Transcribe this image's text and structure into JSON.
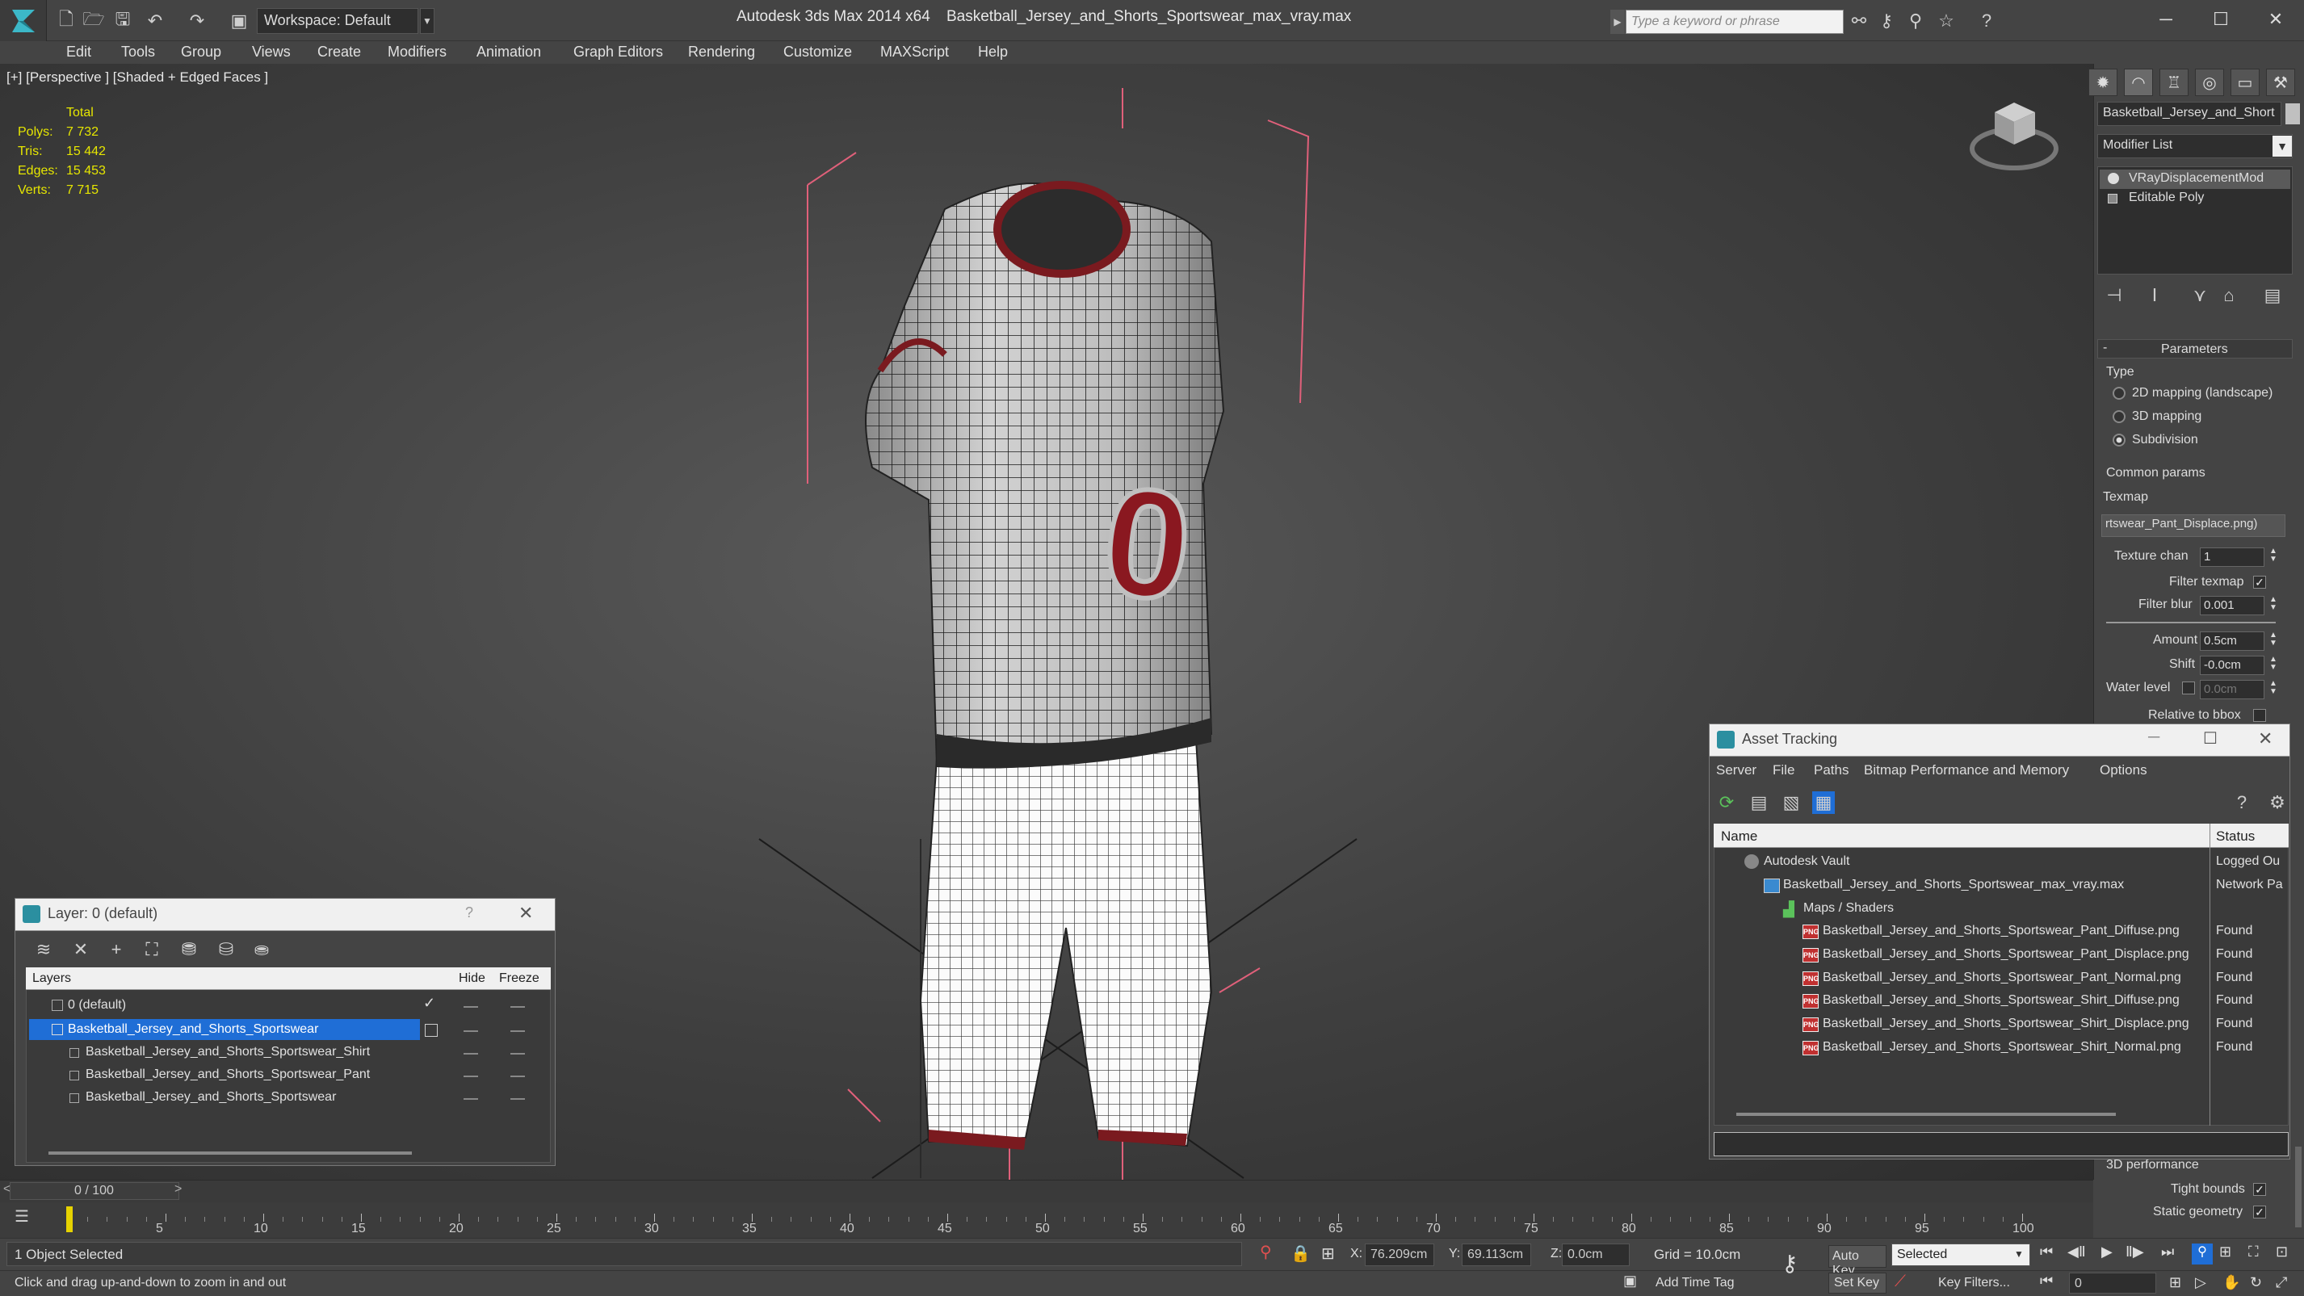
{
  "app": {
    "title": "Autodesk 3ds Max  2014 x64",
    "file": "Basketball_Jersey_and_Shorts_Sportswear_max_vray.max",
    "workspace": "Workspace: Default",
    "search_placeholder": "Type a keyword or phrase"
  },
  "menu": [
    "Edit",
    "Tools",
    "Group",
    "Views",
    "Create",
    "Modifiers",
    "Animation",
    "Graph Editors",
    "Rendering",
    "Customize",
    "MAXScript",
    "Help"
  ],
  "viewport": {
    "label": "[+] [Perspective ] [Shaded + Edged Faces ]",
    "stats": {
      "header": "Total",
      "rows": [
        {
          "label": "Polys:",
          "value": "7 732"
        },
        {
          "label": "Tris:",
          "value": "15 442"
        },
        {
          "label": "Edges:",
          "value": "15 453"
        },
        {
          "label": "Verts:",
          "value": "7 715"
        }
      ]
    },
    "jersey_number": "0"
  },
  "command_panel": {
    "object_name": "Basketball_Jersey_and_Short",
    "modifier_list": "Modifier List",
    "stack": [
      "VRayDisplacementMod",
      "Editable Poly"
    ],
    "rollout_title": "Parameters",
    "type_label": "Type",
    "type_options": [
      {
        "label": "2D mapping (landscape)",
        "selected": false
      },
      {
        "label": "3D mapping",
        "selected": false
      },
      {
        "label": "Subdivision",
        "selected": true
      }
    ],
    "common_params": "Common params",
    "texmap_label": "Texmap",
    "texmap_value": "rtswear_Pant_Displace.png)",
    "texture_chan_label": "Texture chan",
    "texture_chan_value": "1",
    "filter_texmap_label": "Filter texmap",
    "filter_texmap_checked": true,
    "filter_blur_label": "Filter blur",
    "filter_blur_value": "0.001",
    "amount_label": "Amount",
    "amount_value": "0.5cm",
    "shift_label": "Shift",
    "shift_value": "-0.0cm",
    "water_level_label": "Water level",
    "water_level_value": "0.0cm",
    "relative_bbox_label": "Relative to bbox",
    "perf_label": "3D performance",
    "tight_bounds_label": "Tight bounds",
    "tight_bounds_checked": true,
    "static_geometry_label": "Static geometry",
    "static_geometry_checked": true
  },
  "layer_window": {
    "title": "Layer: 0 (default)",
    "help": "?",
    "columns": {
      "layers": "Layers",
      "hide": "Hide",
      "freeze": "Freeze"
    },
    "rows": [
      {
        "name": "0 (default)",
        "indent": 0,
        "selected": false,
        "current": true
      },
      {
        "name": "Basketball_Jersey_and_Shorts_Sportswear",
        "indent": 0,
        "selected": true,
        "current": false
      },
      {
        "name": "Basketball_Jersey_and_Shorts_Sportswear_Shirt",
        "indent": 1,
        "selected": false,
        "current": false
      },
      {
        "name": "Basketball_Jersey_and_Shorts_Sportswear_Pant",
        "indent": 1,
        "selected": false,
        "current": false
      },
      {
        "name": "Basketball_Jersey_and_Shorts_Sportswear",
        "indent": 1,
        "selected": false,
        "current": false
      }
    ]
  },
  "asset_window": {
    "title": "Asset Tracking",
    "menu": [
      "Server",
      "File",
      "Paths",
      "Bitmap Performance and Memory",
      "Options"
    ],
    "columns": {
      "name": "Name",
      "status": "Status"
    },
    "rows": [
      {
        "name": "Autodesk Vault",
        "status": "Logged Ou",
        "indent": 0,
        "icon": "vault"
      },
      {
        "name": "Basketball_Jersey_and_Shorts_Sportswear_max_vray.max",
        "status": "Network Pa",
        "indent": 1,
        "icon": "max"
      },
      {
        "name": "Maps / Shaders",
        "status": "",
        "indent": 2,
        "icon": "maps"
      },
      {
        "name": "Basketball_Jersey_and_Shorts_Sportswear_Pant_Diffuse.png",
        "status": "Found",
        "indent": 3,
        "icon": "png"
      },
      {
        "name": "Basketball_Jersey_and_Shorts_Sportswear_Pant_Displace.png",
        "status": "Found",
        "indent": 3,
        "icon": "png"
      },
      {
        "name": "Basketball_Jersey_and_Shorts_Sportswear_Pant_Normal.png",
        "status": "Found",
        "indent": 3,
        "icon": "png"
      },
      {
        "name": "Basketball_Jersey_and_Shorts_Sportswear_Shirt_Diffuse.png",
        "status": "Found",
        "indent": 3,
        "icon": "png"
      },
      {
        "name": "Basketball_Jersey_and_Shorts_Sportswear_Shirt_Displace.png",
        "status": "Found",
        "indent": 3,
        "icon": "png"
      },
      {
        "name": "Basketball_Jersey_and_Shorts_Sportswear_Shirt_Normal.png",
        "status": "Found",
        "indent": 3,
        "icon": "png"
      }
    ]
  },
  "timeline": {
    "frame": "0 / 100",
    "prev": "<",
    "next": ">",
    "ticks": [
      "5",
      "10",
      "15",
      "20",
      "25",
      "30",
      "35",
      "40",
      "45",
      "50",
      "55",
      "60",
      "65",
      "70",
      "75",
      "80",
      "85",
      "90",
      "95",
      "100"
    ]
  },
  "status": {
    "selection": "1 Object Selected",
    "prompt": "Click and drag up-and-down to zoom in and out",
    "x_label": "X:",
    "x_value": "76.209cm",
    "y_label": "Y:",
    "y_value": "69.113cm",
    "z_label": "Z:",
    "z_value": "0.0cm",
    "grid": "Grid = 10.0cm",
    "add_time_tag": "Add Time Tag",
    "auto_key": "Auto Key",
    "selected": "Selected",
    "set_key": "Set Key",
    "key_filters": "Key Filters...",
    "frame_field": "0"
  },
  "colors": {
    "selection_blue": "#1f6ed6",
    "stat_yellow": "#e6e600",
    "jersey_red": "#8a1820",
    "gizmo_pink": "#e0607a"
  }
}
